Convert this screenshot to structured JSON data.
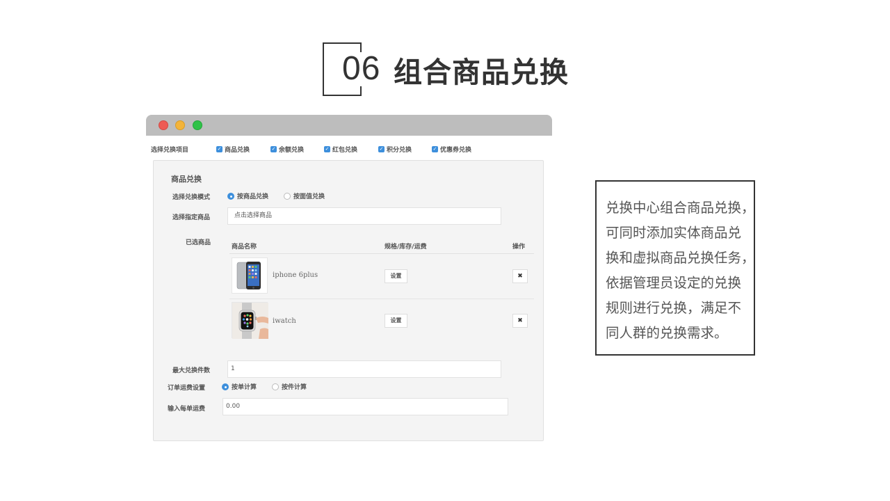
{
  "slide": {
    "number": "06",
    "title": "组合商品兑换"
  },
  "window_controls": [
    "close",
    "minimize",
    "maximize"
  ],
  "exchange_items": {
    "label": "选择兑换项目",
    "options": [
      {
        "label": "商品兑换",
        "checked": true
      },
      {
        "label": "余额兑换",
        "checked": true
      },
      {
        "label": "红包兑换",
        "checked": true
      },
      {
        "label": "积分兑换",
        "checked": true
      },
      {
        "label": "优惠券兑换",
        "checked": true
      }
    ]
  },
  "panel": {
    "title": "商品兑换",
    "mode": {
      "label": "选择兑换模式",
      "options": [
        {
          "label": "按商品兑换",
          "selected": true
        },
        {
          "label": "按面值兑换",
          "selected": false
        }
      ]
    },
    "product_select": {
      "label": "选择指定商品",
      "value": "点击选择商品"
    },
    "selected_products": {
      "label": "已选商品",
      "columns": [
        "商品名称",
        "规格/库存/运费",
        "操作"
      ],
      "rows": [
        {
          "name": "iphone 6plus",
          "spec_button": "设置",
          "delete_icon": "✖",
          "image_icon": "iphone-thumbnail"
        },
        {
          "name": "iwatch",
          "spec_button": "设置",
          "delete_icon": "✖",
          "image_icon": "watch-thumbnail"
        }
      ]
    },
    "max_count": {
      "label": "最大兑换件数",
      "value": "1"
    },
    "shipping": {
      "label": "订单运费设置",
      "options": [
        {
          "label": "按单计算",
          "selected": true
        },
        {
          "label": "按件计算",
          "selected": false
        }
      ]
    },
    "shipping_fee": {
      "label": "输入每单运费",
      "value": "0.00"
    }
  },
  "description": {
    "lines": [
      "兑换中心组合商品兑换，",
      "可同时添加实体商品兑",
      "换和虚拟商品兑换任务，",
      "依据管理员设定的兑换",
      "规则进行兑换，满足不",
      "同人群的兑换需求。"
    ]
  },
  "colors": {
    "accent": "#3d8fdc",
    "close_dot": "#ee5b55",
    "minimize_dot": "#f3b43a",
    "maximize_dot": "#2fc247"
  }
}
